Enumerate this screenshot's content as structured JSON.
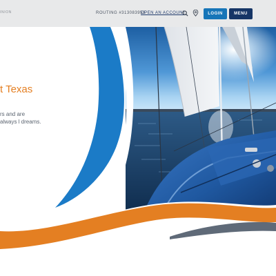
{
  "header": {
    "brand_fragment": "inion",
    "routing_text": "ROUTING #313083953",
    "open_account_label": "OPEN AN ACCOUNT",
    "login_label": "LOGIN",
    "menu_label": "MENU",
    "icons": {
      "search": "search-icon",
      "location": "location-pin-icon"
    }
  },
  "hero": {
    "headline": "t Texas",
    "subtext": "rs and are always l dreams.",
    "image": "sailboat-on-lake",
    "colors": {
      "accent_orange": "#e47f22",
      "sail_blue": "#1b7bc7",
      "navy": "#163566",
      "wave_gray": "#5f6a78"
    }
  }
}
